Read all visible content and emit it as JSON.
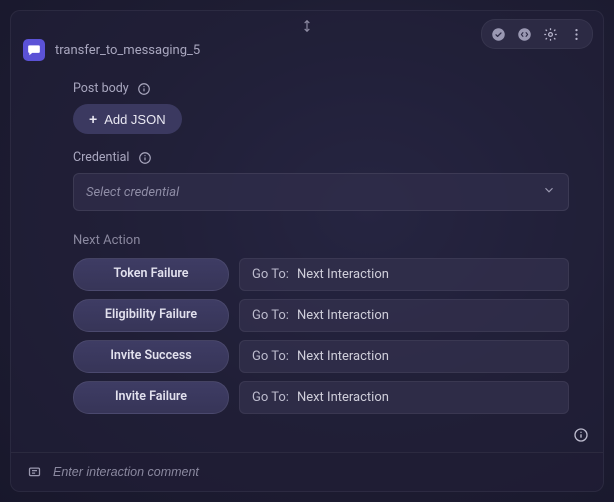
{
  "header": {
    "title": "transfer_to_messaging_5"
  },
  "postBody": {
    "label": "Post body",
    "addButton": "Add JSON",
    "plus": "+"
  },
  "credential": {
    "label": "Credential",
    "placeholder": "Select credential"
  },
  "nextAction": {
    "label": "Next Action",
    "gotoLabel": "Go To:",
    "rows": [
      {
        "outcome": "Token Failure",
        "target": "Next Interaction"
      },
      {
        "outcome": "Eligibility Failure",
        "target": "Next Interaction"
      },
      {
        "outcome": "Invite Success",
        "target": "Next Interaction"
      },
      {
        "outcome": "Invite Failure",
        "target": "Next Interaction"
      }
    ]
  },
  "comment": {
    "placeholder": "Enter interaction comment"
  }
}
